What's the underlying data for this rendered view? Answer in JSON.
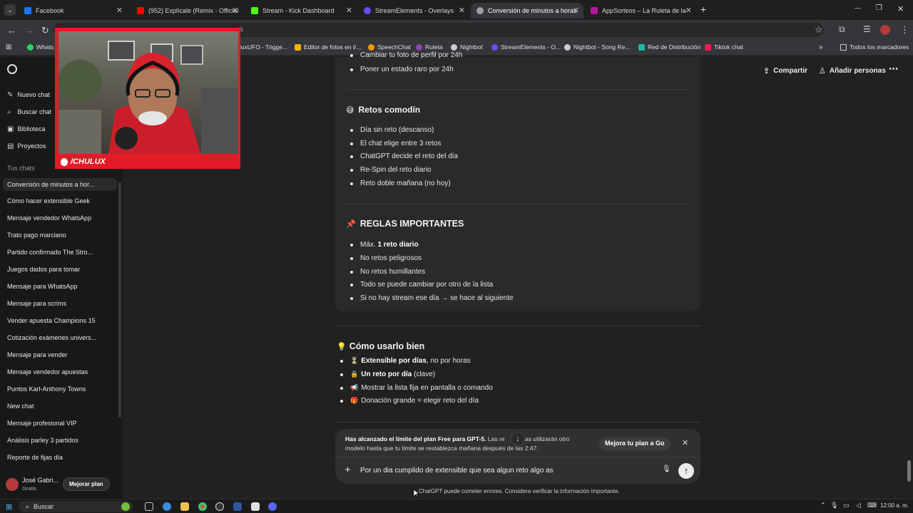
{
  "tabs": [
    {
      "title": "Facebook",
      "color": "#1877f2"
    },
    {
      "title": "(952) Explícale (Remix - Official",
      "color": "#ff0000"
    },
    {
      "title": "Stream - Kick Dashboard",
      "color": "#53fc18"
    },
    {
      "title": "StreamElements - Overlays",
      "color": "#6c4bff"
    },
    {
      "title": "Conversión de minutos a horas",
      "color": "#9aa0a6"
    },
    {
      "title": "AppSorteos – La Ruleta de la Su",
      "color": "#b5179e"
    }
  ],
  "window": {
    "new_tab": "+",
    "minimize": "—",
    "restore": "❐",
    "close": "✕"
  },
  "address": {
    "text": "a"
  },
  "bookmarks": [
    {
      "label": "Whats",
      "color": "#25d366"
    },
    {
      "label": "luxUFO - Trigge...",
      "color": "#888888"
    },
    {
      "label": "Editor de fotos en l/...",
      "color": "#f4b400"
    },
    {
      "label": "SpeechChat",
      "color": "#f29900"
    },
    {
      "label": "Ruleta",
      "color": "#8e44ad"
    },
    {
      "label": "Nightbot",
      "color": "#cccccc"
    },
    {
      "label": "StreamElements - O...",
      "color": "#6c4bff"
    },
    {
      "label": "Nightbot - Song Re...",
      "color": "#cccccc"
    },
    {
      "label": "Red de Distribución",
      "color": "#1abc9c"
    },
    {
      "label": "Tiktok chat",
      "color": "#ee1d52"
    }
  ],
  "bookmarks_all": "Todos los marcadores",
  "sidebar": {
    "nav": [
      {
        "label": "Nuevo chat",
        "icon": "✎"
      },
      {
        "label": "Buscar chat",
        "icon": "⌕"
      },
      {
        "label": "Biblioteca",
        "icon": "▣"
      },
      {
        "label": "Proyectos",
        "icon": "▤"
      }
    ],
    "section_title": "Tus chats",
    "chats": [
      "Conversión de minutos a hor...",
      "Cómo hacer extensible Geek",
      "Mensaje vendedor WhatsApp",
      "Trato pago marciano",
      "Partido confirmado The Stro...",
      "Juegos dados para tomar",
      "Mensaje para WhatsApp",
      "Mensaje para scrims",
      "Vender apuesta Champions 15",
      "Cotización exámenes univers...",
      "Mensaje para vender",
      "Mensaje vendedor apuestas",
      "Puntos Karl-Anthony Towns",
      "New chat",
      "Mensaje profesional VIP",
      "Análisis parley 3 partidos",
      "Reporte de fijas día"
    ],
    "user_name": "José Gabri...",
    "user_plan": "Gratis",
    "upgrade_label": "Mejorar plan"
  },
  "webcam": {
    "label": "/CHULUX"
  },
  "header": {
    "share": "Compartir",
    "add_people": "Añadir personas",
    "more": "⋯"
  },
  "content": {
    "top_items": [
      "Cambiar tu foto de perfil por 24h",
      "Poner un estado raro por 24h"
    ],
    "section1": {
      "emoji": "😅",
      "title": "Retos comodín",
      "items": [
        "Día sin reto (descanso)",
        "El chat elige entre 3 retos",
        "ChatGPT decide el reto del día",
        "Re-Spin del reto diario",
        "Reto doble mañana (no hoy)"
      ]
    },
    "section2": {
      "emoji": "📌",
      "title": "REGLAS IMPORTANTES",
      "item1_pre": "Máx. ",
      "item1_bold": "1 reto diario",
      "items": [
        "No retos peligrosos",
        "No retos humillantes",
        "Todo se puede cambiar por otro de la lista",
        "Si no hay stream ese día → se hace al siguiente"
      ]
    },
    "section3": {
      "emoji": "💡",
      "title": "Cómo usarlo bien",
      "items": [
        {
          "emoji": "⏳",
          "bold": "Extensible por días",
          "rest": ", no por horas"
        },
        {
          "emoji": "🔒",
          "bold": "Un reto por día",
          "rest": " (clave)"
        },
        {
          "emoji": "📢",
          "bold": "",
          "rest": "Mostrar la lista fija en pantalla o comando"
        },
        {
          "emoji": "🎁",
          "bold": "",
          "rest": "Donación grande = elegir reto del día"
        }
      ]
    }
  },
  "limit_banner": {
    "bold": "Has alcanzado el límite del plan Free para GPT-5.",
    "text1": " Las re",
    "text2": "stas utilizarán otro",
    "line2": "modelo hasta que tu límite se restablezca mañana después de las 2:47.",
    "button": "Mejora tu plan a Go",
    "close": "✕"
  },
  "composer": {
    "value": "Por un dia cumplido de extensible que sea algun reto algo as",
    "plus": "+",
    "mic": "🎙",
    "send": "↑"
  },
  "disclaimer": "ChatGPT puede cometer errores. Considera verificar la información importante.",
  "taskbar": {
    "search": "Buscar",
    "time": "12:00 a. m."
  }
}
